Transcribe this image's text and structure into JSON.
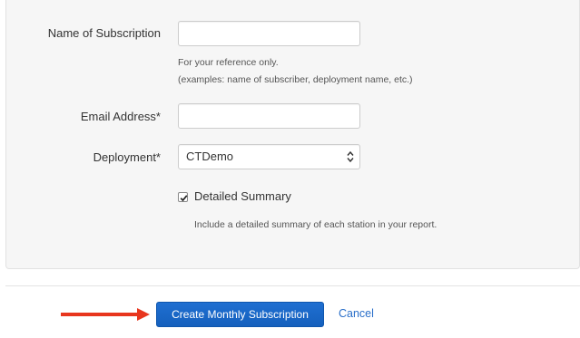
{
  "form": {
    "name_label": "Name of Subscription",
    "name_value": "",
    "name_help_line1": "For your reference only.",
    "name_help_line2": "(examples: name of subscriber, deployment name, etc.)",
    "email_label": "Email Address*",
    "email_value": "",
    "deployment_label": "Deployment*",
    "deployment_selected": "CTDemo",
    "detailed_summary_checked": true,
    "detailed_summary_label": "Detailed Summary",
    "detailed_summary_help": "Include a detailed summary of each station in your report."
  },
  "actions": {
    "submit_label": "Create Monthly Subscription",
    "cancel_label": "Cancel"
  },
  "colors": {
    "annotation_arrow": "#e8361e",
    "primary_button": "#1a66c8",
    "link": "#2a6fc9"
  },
  "icons": {
    "select_arrows": "up-down-chevron-icon",
    "checkbox_check": "checkmark-icon",
    "pointer_arrow": "right-arrow-icon"
  }
}
